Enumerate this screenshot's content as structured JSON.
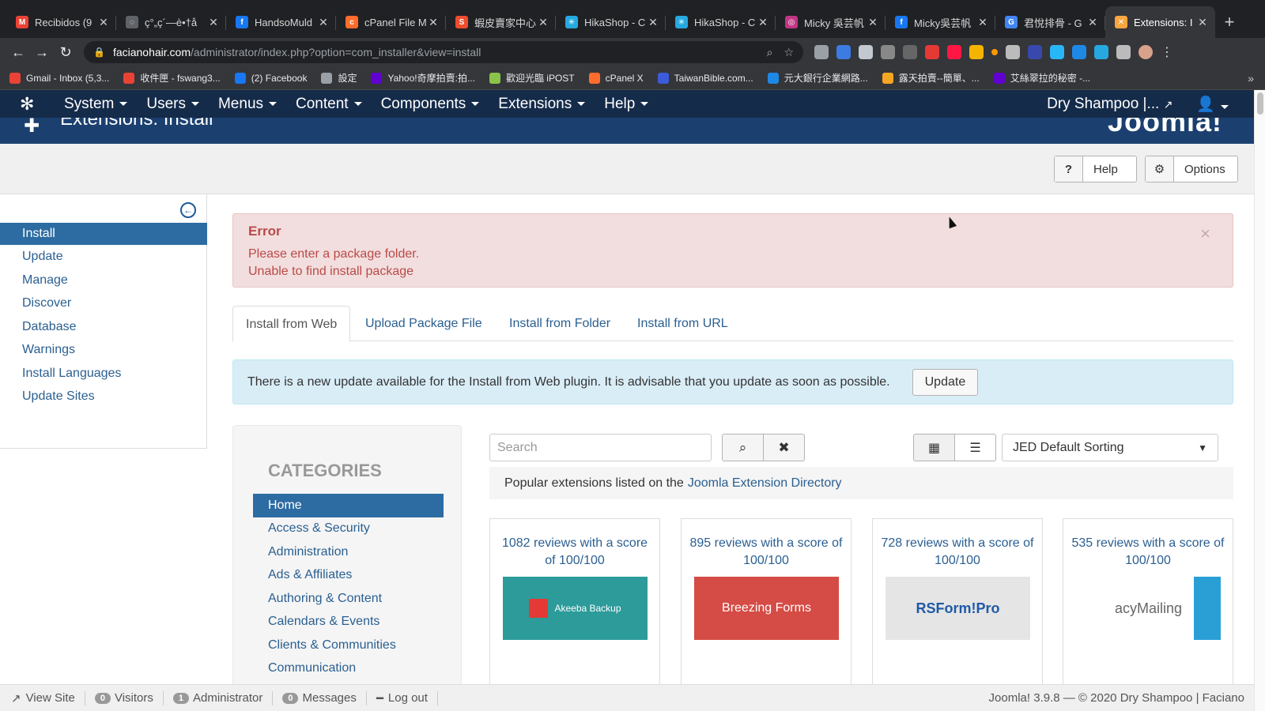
{
  "browser": {
    "tabs": [
      {
        "label": "Recibidos (9",
        "fav_color": "#ea4335",
        "fav_text": "M"
      },
      {
        "label": "ç°„ç´—è•†å",
        "fav_color": "#5f6368",
        "fav_text": "◌"
      },
      {
        "label": "HandsoMuld",
        "fav_color": "#1877f2",
        "fav_text": "f"
      },
      {
        "label": "cPanel File M",
        "fav_color": "#ff6c2c",
        "fav_text": "c"
      },
      {
        "label": "蝦皮賣家中心",
        "fav_color": "#ee4d2d",
        "fav_text": "S"
      },
      {
        "label": "HikaShop - C",
        "fav_color": "#26a9e0",
        "fav_text": "✳"
      },
      {
        "label": "HikaShop - C",
        "fav_color": "#26a9e0",
        "fav_text": "✳"
      },
      {
        "label": "Micky 吳芸帆",
        "fav_color": "#c13584",
        "fav_text": "◎"
      },
      {
        "label": "Micky吳芸帆",
        "fav_color": "#1877f2",
        "fav_text": "f"
      },
      {
        "label": "君悅排骨 - G",
        "fav_color": "#4285f4",
        "fav_text": "G"
      },
      {
        "label": "Extensions: I",
        "fav_color": "#f9a541",
        "fav_text": "✕",
        "active": true
      }
    ],
    "new_tab_symbol": "+",
    "url_host": "facianohair.com",
    "url_path": "/administrator/index.php?option=com_installer&view=install",
    "bookmarks": [
      {
        "label": "Gmail - Inbox (5,3...",
        "color": "#ea4335"
      },
      {
        "label": "收件匣 - fswang3...",
        "color": "#ea4335"
      },
      {
        "label": "(2) Facebook",
        "color": "#1877f2"
      },
      {
        "label": "設定",
        "color": "#9aa0a6"
      },
      {
        "label": "Yahoo!奇摩拍賣:拍...",
        "color": "#6001d2"
      },
      {
        "label": "歡迎光臨 iPOST",
        "color": "#8bc34a"
      },
      {
        "label": "cPanel X",
        "color": "#ff6c2c"
      },
      {
        "label": "TaiwanBible.com...",
        "color": "#3b5bdb"
      },
      {
        "label": "元大銀行企業網路...",
        "color": "#1e88e5"
      },
      {
        "label": "露天拍賣--簡單、...",
        "color": "#f5a623"
      },
      {
        "label": "艾絲翠拉的秘密 -...",
        "color": "#6001d2"
      }
    ],
    "bookmarks_more": "»"
  },
  "joomla": {
    "menu": [
      "System",
      "Users",
      "Menus",
      "Content",
      "Components",
      "Extensions",
      "Help"
    ],
    "site_name": "Dry Shampoo |...",
    "page_title": "Extensions: Install",
    "brand": "Joomla!",
    "toolbar": {
      "help_label": "Help",
      "options_label": "Options"
    },
    "sidebar": {
      "items": [
        "Install",
        "Update",
        "Manage",
        "Discover",
        "Database",
        "Warnings",
        "Install Languages",
        "Update Sites"
      ],
      "active_index": 0
    },
    "error": {
      "heading": "Error",
      "lines": [
        "Please enter a package folder.",
        "Unable to find install package"
      ],
      "close": "×"
    },
    "install_tabs": [
      "Install from Web",
      "Upload Package File",
      "Install from Folder",
      "Install from URL"
    ],
    "update_notice": {
      "text": "There is a new update available for the Install from Web plugin. It is advisable that you update as soon as possible.",
      "button": "Update"
    },
    "categories": {
      "heading": "CATEGORIES",
      "items": [
        "Home",
        "Access & Security",
        "Administration",
        "Ads & Affiliates",
        "Authoring & Content",
        "Calendars & Events",
        "Clients & Communities",
        "Communication"
      ],
      "active_index": 0
    },
    "search": {
      "placeholder": "Search",
      "sort": "JED Default Sorting"
    },
    "popular": {
      "text": "Popular extensions listed on the",
      "link": "Joomla Extension Directory"
    },
    "extensions": [
      {
        "reviews": "1082 reviews with a score of 100/100",
        "thumb_text": "Akeeba Backup",
        "thumb_bg": "#2c9b9a"
      },
      {
        "reviews": "895 reviews with a score of 100/100",
        "thumb_text": "Breezing Forms",
        "thumb_bg": "#d54b45"
      },
      {
        "reviews": "728 reviews with a score of 100/100",
        "thumb_text": "RSForm!Pro",
        "thumb_bg": "#e5e5e5"
      },
      {
        "reviews": "535 reviews with a score of 100/100",
        "thumb_text": "acyMailing",
        "thumb_bg": "#ffffff"
      }
    ],
    "status": {
      "view_site": "View Site",
      "visitors_count": "0",
      "visitors": "Visitors",
      "admin_count": "1",
      "admin": "Administrator",
      "messages_count": "0",
      "messages": "Messages",
      "logout": "Log out",
      "version": "Joomla! 3.9.8",
      "copyright": "— © 2020 Dry Shampoo | Faciano"
    }
  }
}
